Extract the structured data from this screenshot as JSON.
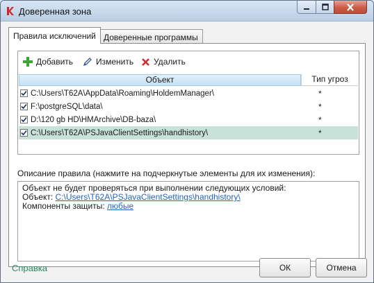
{
  "window": {
    "title": "Доверенная зона"
  },
  "tabs": [
    {
      "label": "Правила исключений",
      "active": true
    },
    {
      "label": "Доверенные программы",
      "active": false
    }
  ],
  "toolbar": {
    "add_label": "Добавить",
    "edit_label": "Изменить",
    "delete_label": "Удалить"
  },
  "table": {
    "columns": [
      "Объект",
      "Тип угроз"
    ],
    "rows": [
      {
        "path": "C:\\Users\\T62A\\AppData\\Roaming\\HoldemManager\\",
        "threat": "*",
        "checked": true,
        "selected": false
      },
      {
        "path": "F:\\postgreSQL\\data\\",
        "threat": "*",
        "checked": true,
        "selected": false
      },
      {
        "path": "D:\\120 gb HD\\HMArchive\\DB-baza\\",
        "threat": "*",
        "checked": true,
        "selected": false
      },
      {
        "path": "C:\\Users\\T62A\\PSJavaClientSettings\\handhistory\\",
        "threat": "*",
        "checked": true,
        "selected": true
      }
    ]
  },
  "description": {
    "label": "Описание правила (нажмите на подчеркнутые элементы для их изменения):",
    "line1": "Объект не будет проверяться при выполнении следующих условий:",
    "object_prefix": "Объект:",
    "object_link": "C:\\Users\\T62A\\PSJavaClientSettings\\handhistory\\",
    "components_prefix": "Компоненты защиты:",
    "components_link": "любые"
  },
  "footer": {
    "help_label": "Справка",
    "ok_label": "ОК",
    "cancel_label": "Отмена"
  },
  "colors": {
    "selected_row": "#c8e2da",
    "help_link": "#2e8a64",
    "link": "#2264b8",
    "close_button": "#c75e48"
  },
  "icons": {
    "add": "plus-icon",
    "edit": "pencil-icon",
    "delete": "x-icon"
  }
}
